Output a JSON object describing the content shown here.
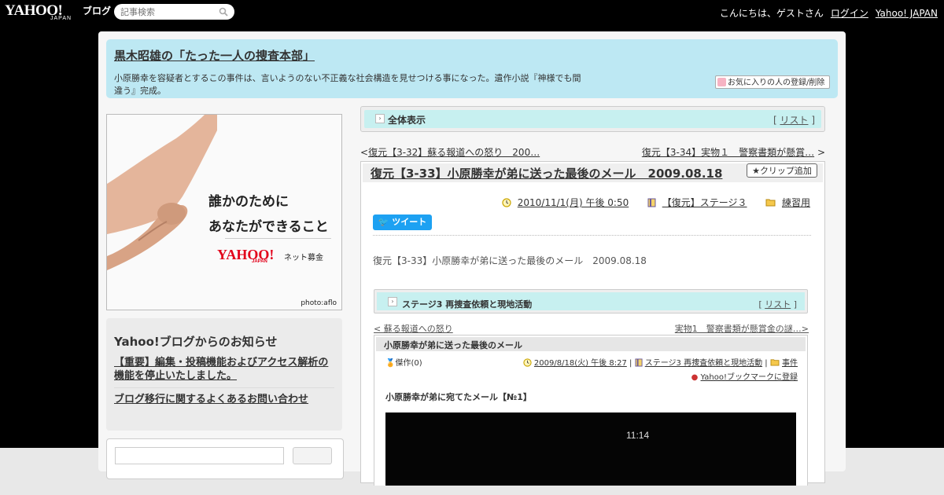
{
  "topbar": {
    "logo_text": "YAHOO!",
    "logo_sub": "JAPAN",
    "logo_blog": "ブログ",
    "search_placeholder": "記事検索",
    "greeting": "こんにちは、ゲストさん",
    "login": "ログイン",
    "yahoo_japan": "Yahoo! JAPAN"
  },
  "blog": {
    "title": "黒木昭雄の「たった一人の捜査本部」",
    "description": "小原勝幸を容疑者とするこの事件は、言いようのない不正義な社会構造を見せつける事になった。遺作小説『神様でも間違う』完成。",
    "fav_button": "お気に入りの人の登録/削除"
  },
  "ad": {
    "line1": "誰かのために",
    "line2": "あなたができること",
    "logo": "YAHOO!",
    "logo_sub": "JAPAN",
    "service": "ネット募金",
    "credit": "photo:aflo"
  },
  "notice": {
    "title": "Yahoo!ブログからのお知らせ",
    "link1": "【重要】編集・投稿機能およびアクセス解析の機能を停止いたしました。",
    "link2": "ブログ移行に関するよくあるお問い合わせ"
  },
  "category": {
    "label": "全体表示",
    "bracket_open": "[",
    "list": "リスト",
    "bracket_close": "]"
  },
  "nav": {
    "prev_mark": "<",
    "prev": "復元【3-32】蘇る報道への怒り　200…",
    "next": "復元【3-34】実物１　警察書類が懸賞…",
    "next_mark": ">"
  },
  "article": {
    "title": "復元【3-33】小原勝幸が弟に送った最後のメール　2009.08.18",
    "clip_button": "クリップ追加",
    "date": "2010/11/1(月) 午後 0:50",
    "category": "【復元】ステージ３",
    "folder": "練習用",
    "tweet": "ツイート",
    "body": "復元【3-33】小原勝幸が弟に送った最後のメール　2009.08.18"
  },
  "embed": {
    "category": "ステージ3 再捜査依頼と現地活動",
    "list": "リスト",
    "prev": "< 蘇る報道への怒り",
    "next": "実物1　警察書類が懸賞金の謎…>",
    "post_title": "小原勝幸が弟に送った最後のメール",
    "masterpiece": "傑作(0)",
    "date": "2009/8/18(火) 午後 8:27",
    "category2": "ステージ3 再捜査依頼と現地活動",
    "folder": "事件",
    "bookmark": "Yahoo!ブックマークに登録",
    "subtitle": "小原勝幸が弟に宛てたメール【№1】",
    "video_time": "11:14"
  }
}
